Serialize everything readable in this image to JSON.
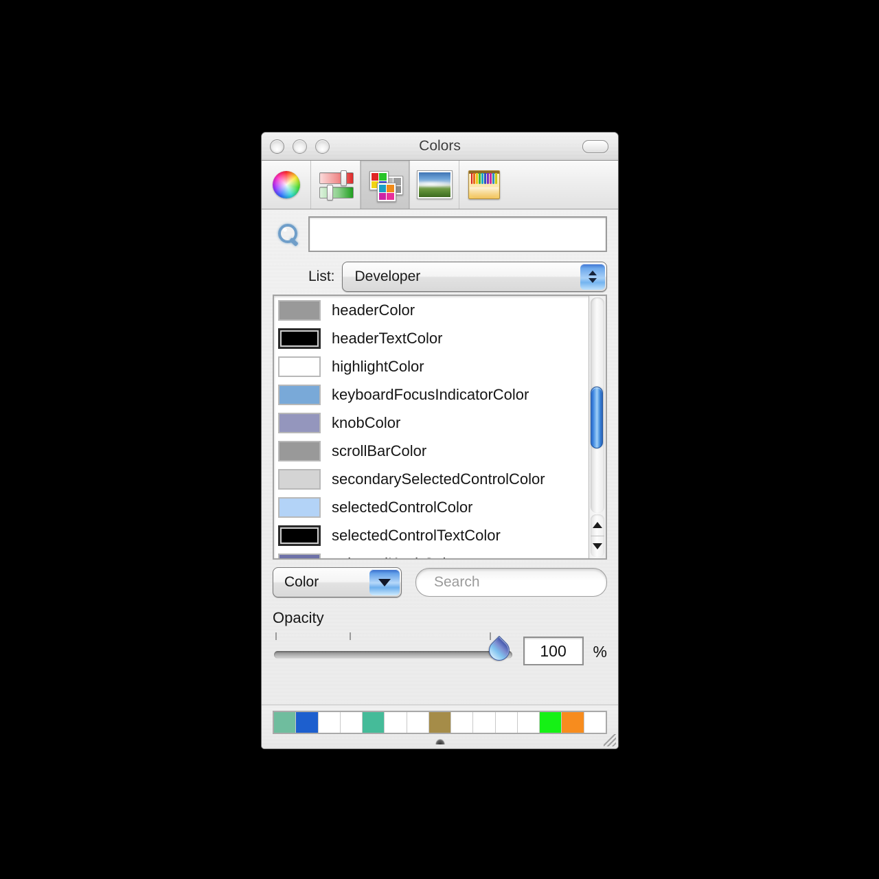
{
  "window": {
    "title": "Colors",
    "traffic_lights": [
      "close",
      "minimize",
      "zoom"
    ],
    "toolbar_toggle": "toolbar-toggle"
  },
  "tabs": [
    {
      "id": "color-wheel",
      "label": "Color Wheel",
      "selected": false
    },
    {
      "id": "color-sliders",
      "label": "Color Sliders",
      "selected": false
    },
    {
      "id": "color-palettes",
      "label": "Color Palettes",
      "selected": true
    },
    {
      "id": "image-palettes",
      "label": "Image Palettes",
      "selected": false
    },
    {
      "id": "crayons",
      "label": "Crayons",
      "selected": false
    }
  ],
  "top_search": {
    "icon": "magnifier-icon",
    "value": "",
    "placeholder": ""
  },
  "list_picker": {
    "label": "List:",
    "value": "Developer"
  },
  "color_list": {
    "items": [
      {
        "name": "headerColor",
        "swatch": "#999999",
        "dark": false
      },
      {
        "name": "headerTextColor",
        "swatch": "#000000",
        "dark": true
      },
      {
        "name": "highlightColor",
        "swatch": "#ffffff",
        "dark": false
      },
      {
        "name": "keyboardFocusIndicatorColor",
        "swatch": "#79a9d8",
        "dark": false
      },
      {
        "name": "knobColor",
        "swatch": "#9496bd",
        "dark": false
      },
      {
        "name": "scrollBarColor",
        "swatch": "#999999",
        "dark": false
      },
      {
        "name": "secondarySelectedControlColor",
        "swatch": "#d4d4d4",
        "dark": false
      },
      {
        "name": "selectedControlColor",
        "swatch": "#b3d3f7",
        "dark": false
      },
      {
        "name": "selectedControlTextColor",
        "swatch": "#000000",
        "dark": true
      },
      {
        "name": "selectedKnobColor",
        "swatch": "#6d71a8",
        "dark": false
      }
    ],
    "scrollbar": {
      "orientation": "vertical",
      "thumb_position_pct": 42
    }
  },
  "bottom_controls": {
    "kind_popup": {
      "value": "Color"
    },
    "search": {
      "value": "",
      "placeholder": "Search"
    }
  },
  "opacity": {
    "label": "Opacity",
    "value": "100",
    "unit": "%",
    "slider_percent": 100,
    "tick_count": 3
  },
  "swatch_tray": {
    "cells": [
      "#6fbd9e",
      "#1d5fce",
      "#ffffff",
      "#ffffff",
      "#45bb99",
      "#ffffff",
      "#ffffff",
      "#a58c48",
      "#ffffff",
      "#ffffff",
      "#ffffff",
      "#ffffff",
      "#15f115",
      "#f78c1e",
      "#ffffff"
    ]
  },
  "palette_icon_colors": {
    "card_a": [
      "#e02525",
      "#28c428",
      "#f2d414",
      "#2b35d4"
    ],
    "card_b": [
      "#b9b9b9",
      "#9d9d9d",
      "#b9b9b9",
      "#8d8d8d"
    ],
    "card_c": [
      "#1a9ec4",
      "#f08a1a",
      "#cc23a5",
      "#e8309a"
    ],
    "spectrum_bars": [
      "#d41f1f",
      "#e86b1a",
      "#e8c81a",
      "#3ab83a",
      "#1aa8c8",
      "#2b4fc8",
      "#7b2bc8",
      "#c82b9e",
      "#2b8ec8",
      "#c8c81a"
    ]
  }
}
